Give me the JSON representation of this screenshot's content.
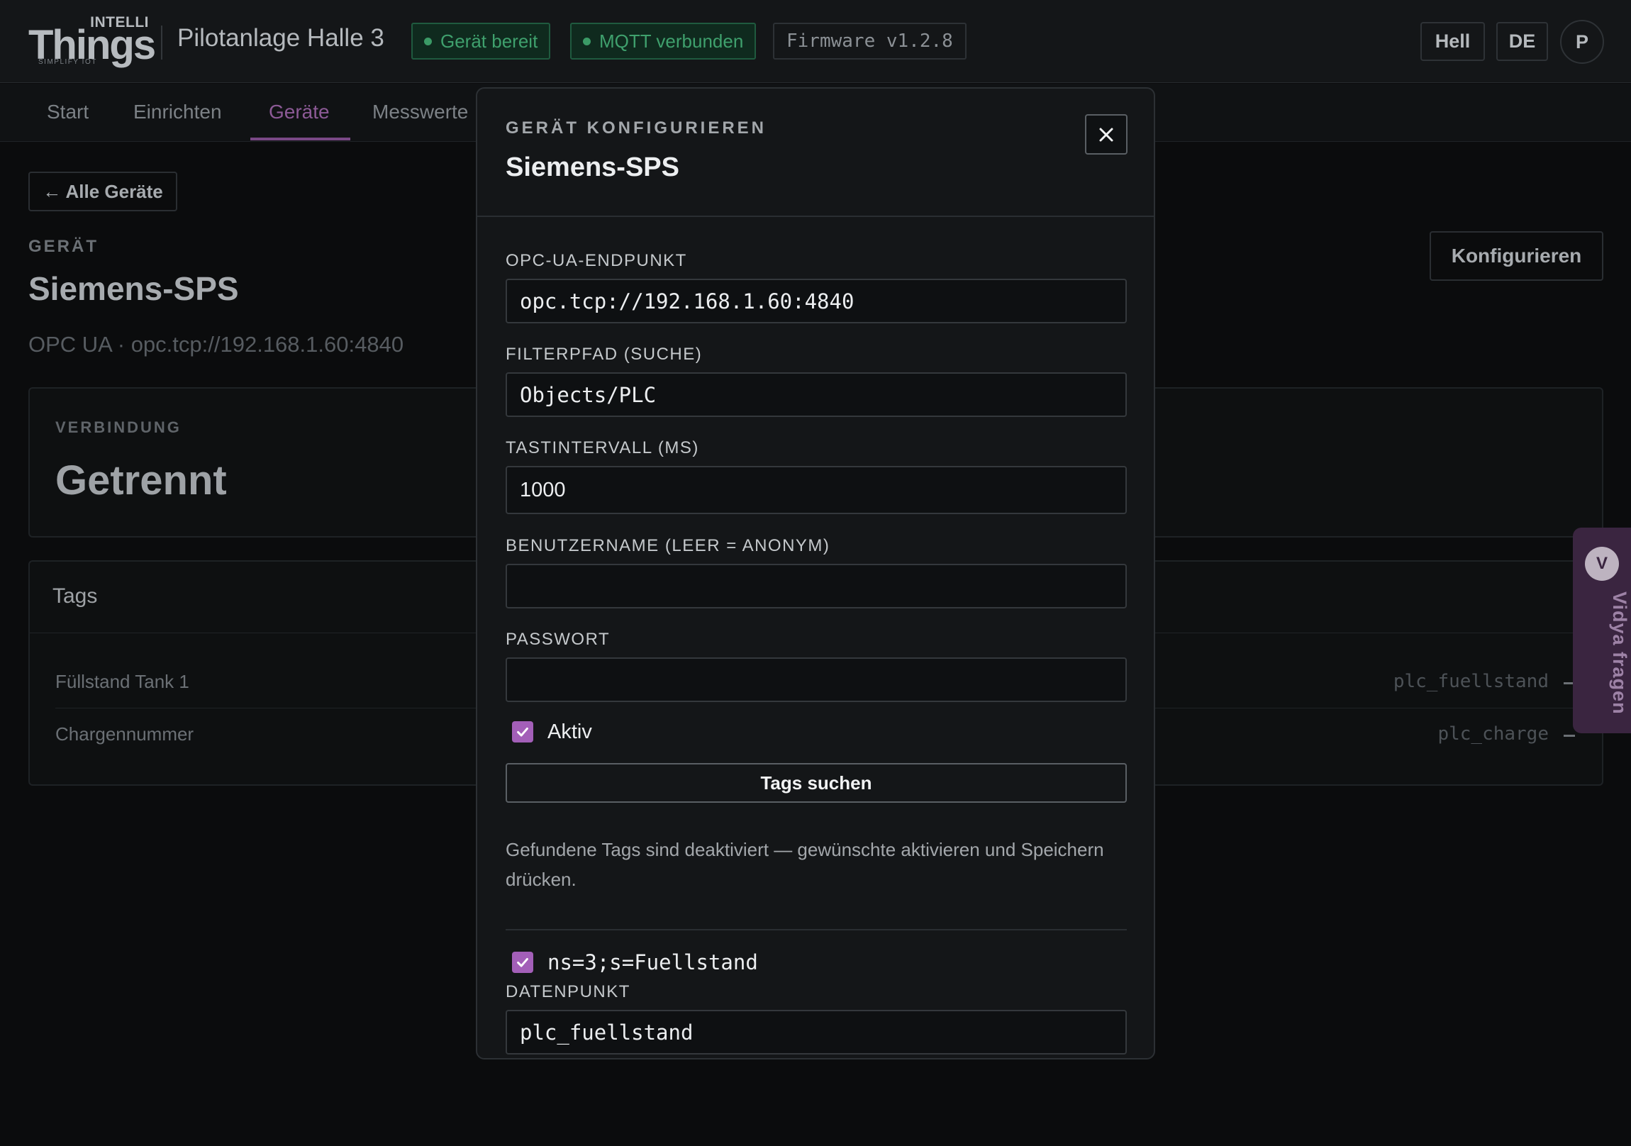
{
  "header": {
    "logo_intelli": "INTELLI",
    "logo_things": "Things",
    "logo_tagline": "SIMPLIFY IOT",
    "plant_name": "Pilotanlage Halle 3",
    "status_device": "Gerät bereit",
    "status_mqtt": "MQTT verbunden",
    "firmware": "Firmware v1.2.8",
    "theme_button": "Hell",
    "lang_button": "DE",
    "avatar_initial": "P"
  },
  "nav": {
    "items": [
      "Start",
      "Einrichten",
      "Geräte",
      "Messwerte"
    ],
    "active": "Geräte"
  },
  "page": {
    "back_button": "← Alle Geräte",
    "device_eyebrow": "GERÄT",
    "device_name": "Siemens-SPS",
    "device_subtitle": "OPC UA · opc.tcp://192.168.1.60:4840",
    "configure_button": "Konfigurieren",
    "connection_eyebrow": "VERBINDUNG",
    "connection_status": "Getrennt",
    "tags_title": "Tags",
    "tags": [
      {
        "label": "Füllstand Tank 1",
        "datapoint": "plc_fuellstand"
      },
      {
        "label": "Chargennummer",
        "datapoint": "plc_charge"
      }
    ]
  },
  "assistant_tab": {
    "initial": "V",
    "label": "Vidya fragen"
  },
  "modal": {
    "eyebrow": "GERÄT KONFIGURIEREN",
    "title": "Siemens-SPS",
    "close_icon": "close-icon",
    "endpoint_label": "OPC-UA-ENDPUNKT",
    "endpoint_value": "opc.tcp://192.168.1.60:4840",
    "filter_label": "FILTERPFAD (SUCHE)",
    "filter_value": "Objects/PLC",
    "interval_label": "TASTINTERVALL (MS)",
    "interval_value": "1000",
    "username_label": "BENUTZERNAME (LEER = ANONYM)",
    "username_value": "",
    "password_label": "PASSWORT",
    "password_value": "",
    "active_label": "Aktiv",
    "active_checked": true,
    "search_button": "Tags suchen",
    "hint": "Gefundene Tags sind deaktiviert — gewünschte aktivieren und Speichern drücken.",
    "found_tag_node": "ns=3;s=Fuellstand",
    "found_tag_checked": true,
    "datapoint_label": "DATENPUNKT",
    "datapoint_value": "plc_fuellstand"
  },
  "colors": {
    "accent": "#a35fb8",
    "status_green": "#3fa06d",
    "background": "#0b0c0d",
    "modal_background": "#141618"
  }
}
